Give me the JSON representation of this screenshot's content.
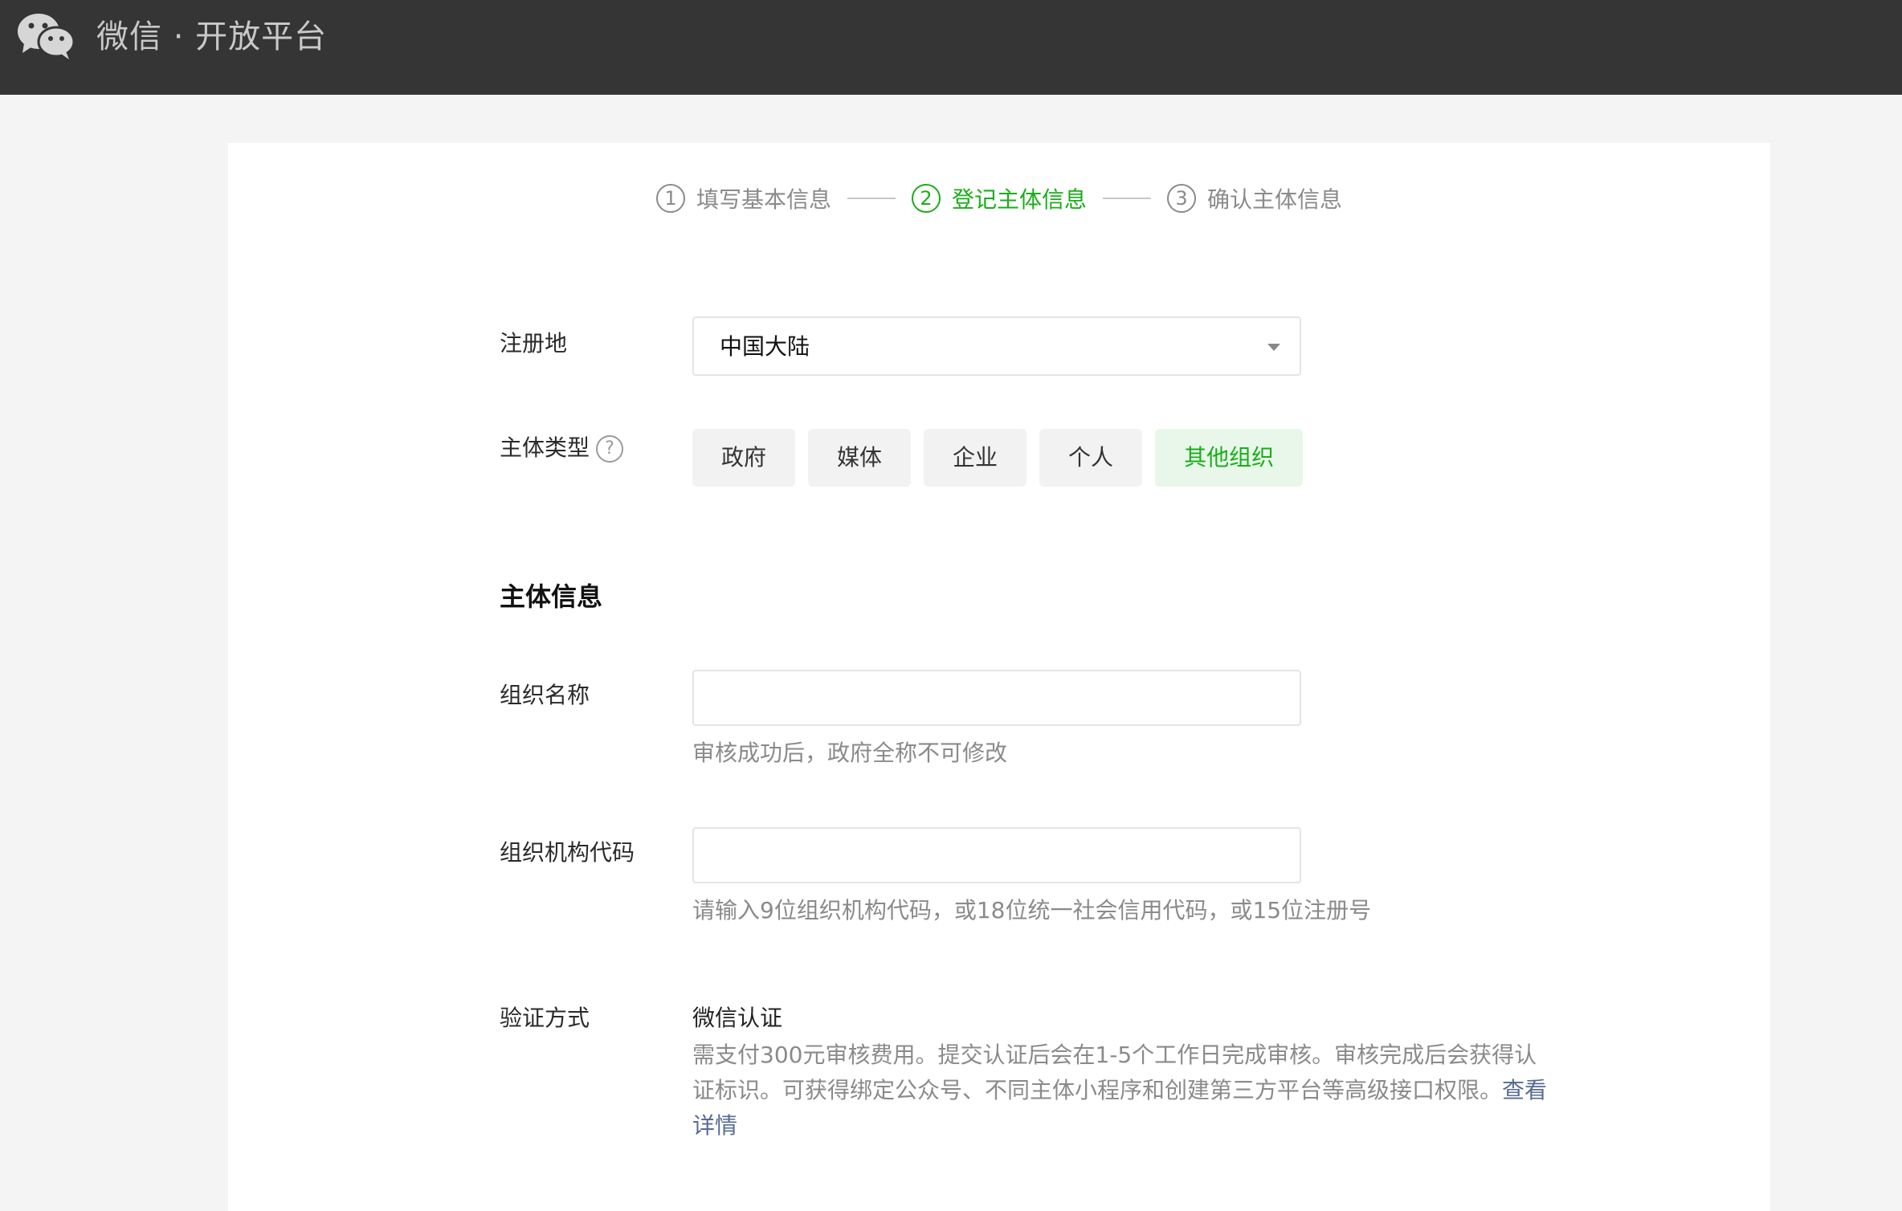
{
  "header": {
    "brand": "微信 · 开放平台"
  },
  "steps": [
    {
      "num": "1",
      "label": "填写基本信息"
    },
    {
      "num": "2",
      "label": "登记主体信息"
    },
    {
      "num": "3",
      "label": "确认主体信息"
    }
  ],
  "form": {
    "region_label": "注册地",
    "region_value": "中国大陆",
    "type_label": "主体类型",
    "help_glyph": "?",
    "types": [
      "政府",
      "媒体",
      "企业",
      "个人",
      "其他组织"
    ],
    "selected_type": "其他组织"
  },
  "entity": {
    "section_title": "主体信息",
    "org_name_label": "组织名称",
    "org_name_value": "",
    "org_name_hint": "审核成功后，政府全称不可修改",
    "org_code_label": "组织机构代码",
    "org_code_value": "",
    "org_code_hint": "请输入9位组织机构代码，或18位统一社会信用代码，或15位注册号",
    "verify_label": "验证方式",
    "verify_title": "微信认证",
    "verify_desc": "需支付300元审核费用。提交认证后会在1-5个工作日完成审核。审核完成后会获得认证标识。可获得绑定公众号、不同主体小程序和创建第三方平台等高级接口权限。",
    "verify_link": "查看详情"
  },
  "colors": {
    "accent": "#1aad19",
    "topbar": "#353535",
    "link": "#576b95"
  },
  "icons": {
    "logo": "wechat-logo-icon",
    "dropdown": "chevron-down-icon",
    "help": "question-circle-icon"
  }
}
